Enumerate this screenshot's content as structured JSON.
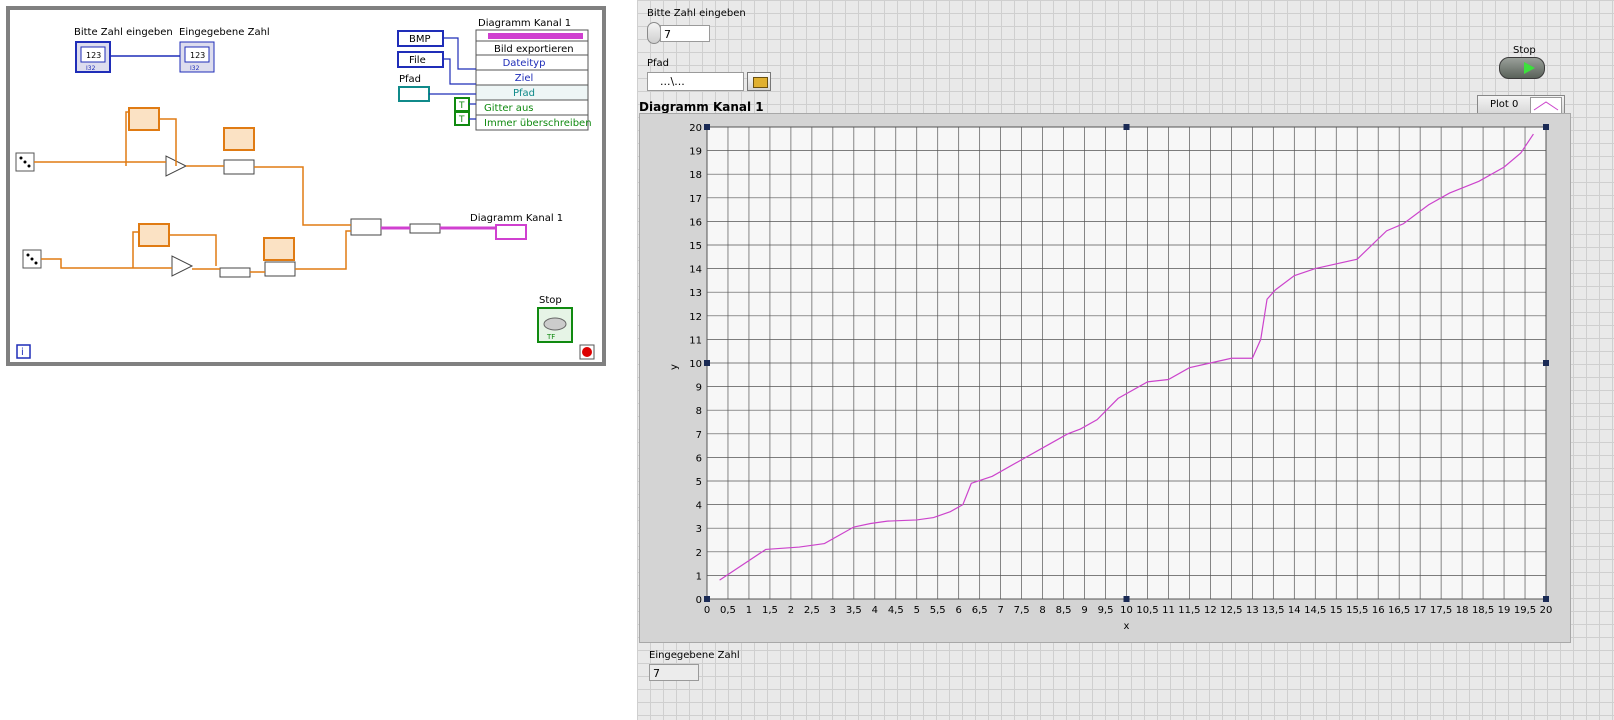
{
  "block_diagram": {
    "label_input": "Bitte Zahl eingeben",
    "label_output": "Eingegebene Zahl",
    "num_icon": "123",
    "io_icon": "I32",
    "enum_bmp": "BMP",
    "enum_file": "File",
    "pfad_label": "Pfad",
    "invoke_title": "Diagramm Kanal 1",
    "invoke_method": "Bild exportieren",
    "invoke_params": [
      "Dateityp",
      "Ziel",
      "Pfad",
      "Gitter aus",
      "Immer überschreiben"
    ],
    "bool_const": "T",
    "chart_terminal_label": "Diagramm Kanal 1",
    "stop_label": "Stop",
    "tf_icon": "TF",
    "iteration_icon": "i"
  },
  "front_panel": {
    "input_label": "Bitte Zahl eingeben",
    "input_value": "7",
    "path_label": "Pfad",
    "path_value": "...\\...",
    "stop_label": "Stop",
    "chart_title": "Diagramm Kanal 1",
    "legend_label": "Plot 0",
    "output_label": "Eingegebene Zahl",
    "output_value": "7",
    "colors": {
      "plot": "#cc44cc",
      "wire_orange": "#e07b13",
      "wire_blue": "#1f2db8",
      "wire_pink": "#d040d0",
      "wire_green": "#108a10"
    }
  },
  "chart_data": {
    "type": "line",
    "title": "Diagramm Kanal 1",
    "xlabel": "x",
    "ylabel": "y",
    "xlim": [
      0,
      20
    ],
    "ylim": [
      0,
      20
    ],
    "xticks": [
      "0",
      "0,5",
      "1",
      "1,5",
      "2",
      "2,5",
      "3",
      "3,5",
      "4",
      "4,5",
      "5",
      "5,5",
      "6",
      "6,5",
      "7",
      "7,5",
      "8",
      "8,5",
      "9",
      "9,5",
      "10",
      "10,5",
      "11",
      "11,5",
      "12",
      "12,5",
      "13",
      "13,5",
      "14",
      "14,5",
      "15",
      "15,5",
      "16",
      "16,5",
      "17",
      "17,5",
      "18",
      "18,5",
      "19",
      "19,5",
      "20"
    ],
    "yticks": [
      "0",
      "1",
      "2",
      "3",
      "4",
      "5",
      "6",
      "7",
      "8",
      "9",
      "10",
      "11",
      "12",
      "13",
      "14",
      "15",
      "16",
      "17",
      "18",
      "19",
      "20"
    ],
    "grid": true,
    "legend": "top-right",
    "series": [
      {
        "name": "Plot 0",
        "x": [
          0.3,
          1.4,
          2.2,
          2.8,
          3.5,
          3.9,
          4.3,
          5.0,
          5.4,
          5.8,
          6.1,
          6.3,
          6.8,
          7.5,
          8.0,
          8.6,
          8.9,
          9.3,
          9.8,
          10.5,
          11.0,
          11.5,
          12.0,
          12.5,
          13.0,
          13.2,
          13.35,
          13.55,
          14.0,
          14.5,
          15.5,
          16.2,
          16.6,
          17.2,
          17.7,
          18.4,
          19.0,
          19.4,
          19.7
        ],
        "y": [
          0.8,
          2.1,
          2.2,
          2.35,
          3.05,
          3.2,
          3.3,
          3.35,
          3.45,
          3.7,
          4.0,
          4.9,
          5.2,
          5.9,
          6.4,
          7.0,
          7.2,
          7.6,
          8.5,
          9.2,
          9.3,
          9.8,
          10.0,
          10.2,
          10.2,
          11.0,
          12.7,
          13.1,
          13.7,
          14.0,
          14.4,
          15.6,
          15.9,
          16.7,
          17.2,
          17.7,
          18.3,
          18.9,
          19.7
        ]
      }
    ]
  }
}
